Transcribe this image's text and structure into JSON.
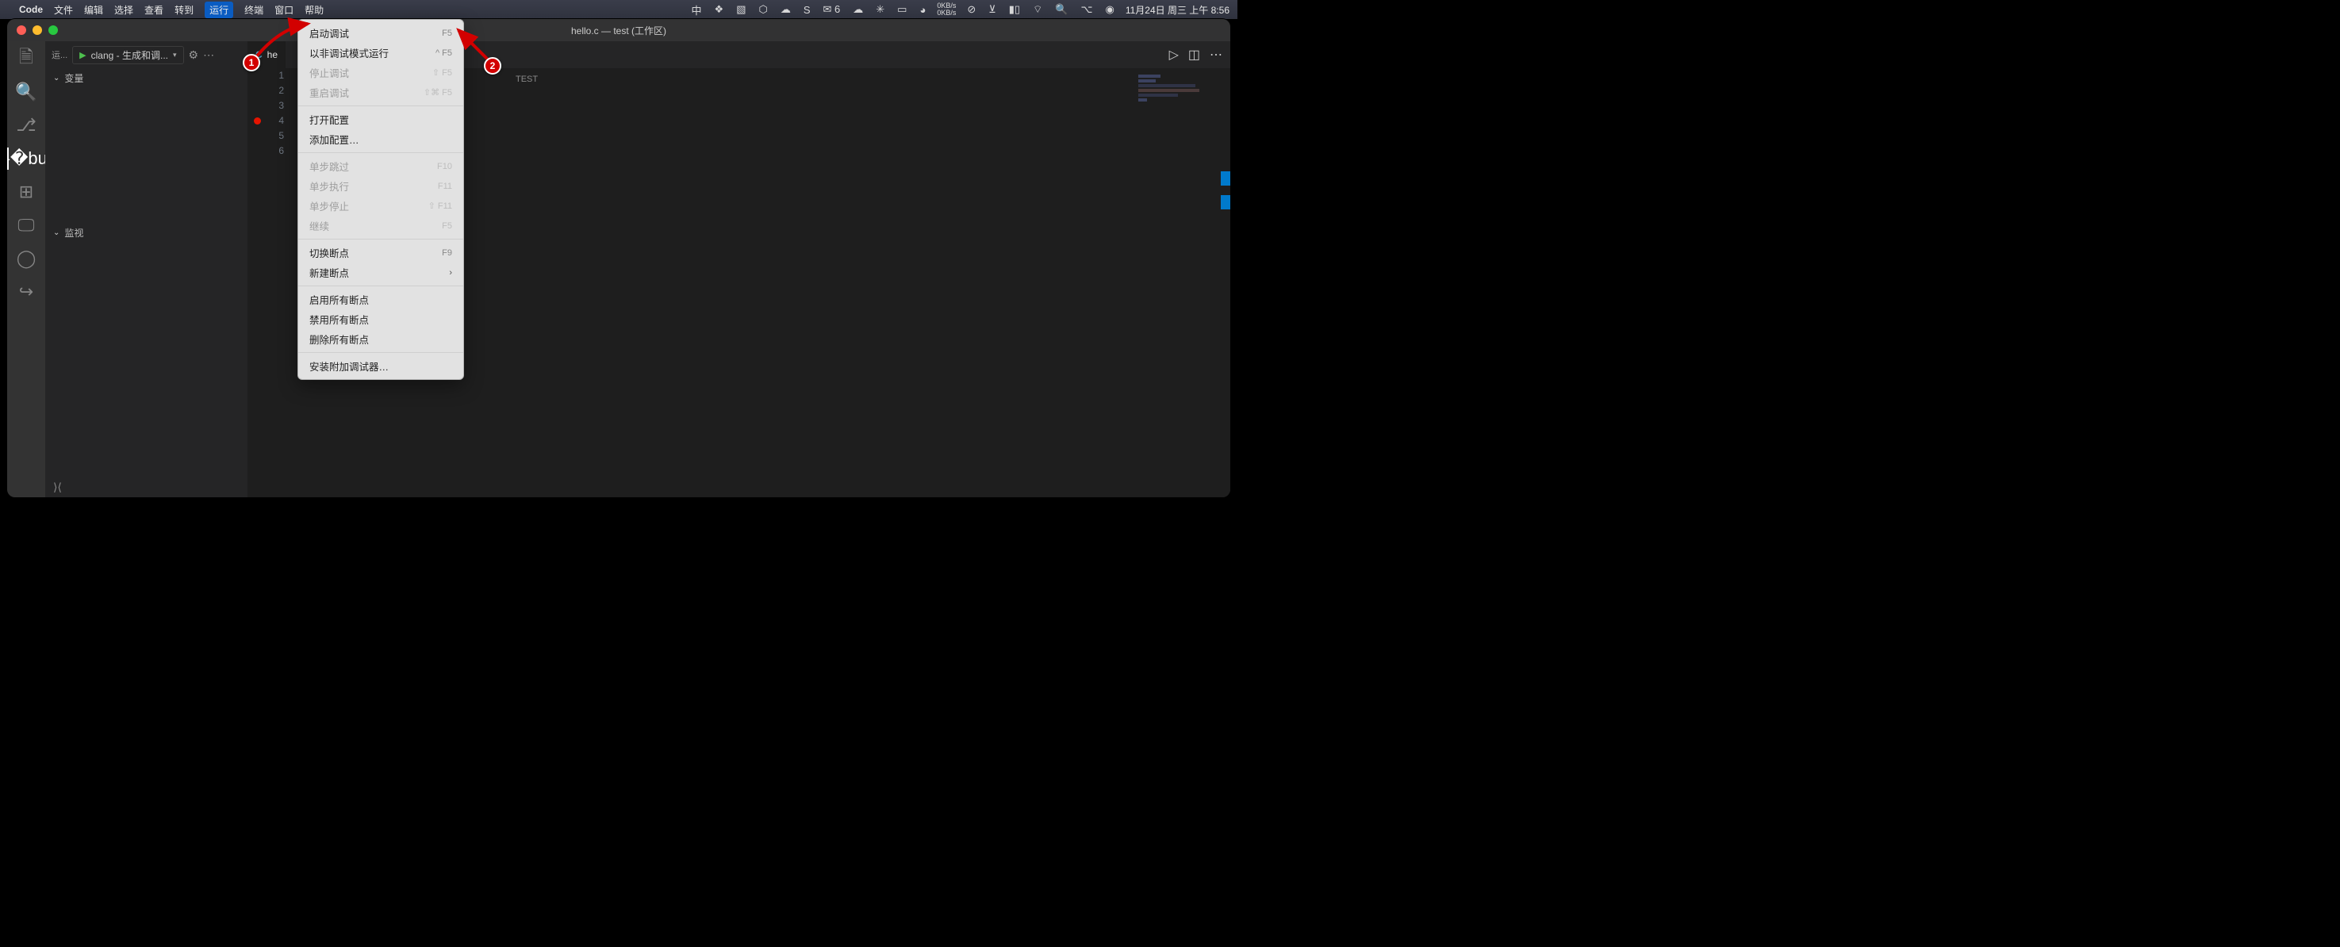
{
  "menubar": {
    "app": "Code",
    "items": [
      "文件",
      "编辑",
      "选择",
      "查看",
      "转到",
      "运行",
      "终端",
      "窗口",
      "帮助"
    ],
    "active_index": 5,
    "ime": "中",
    "netspeed_up": "0KB/s",
    "netspeed_down": "0KB/s",
    "wechat_badge": "6",
    "clock": "11月24日 周三 上午 8:56"
  },
  "window": {
    "title": "hello.c — test (工作区)"
  },
  "debug": {
    "label_short": "运...",
    "config": "clang - 生成和调..."
  },
  "sidebar": {
    "sections": [
      "变量",
      "监视"
    ]
  },
  "tab": {
    "icon": "C",
    "name_partial": "he"
  },
  "editor": {
    "topLabel": "TEST",
    "lines": [
      "1",
      "2",
      "3",
      "4",
      "5",
      "6"
    ],
    "visible_fragment": ");"
  },
  "dropdown": [
    {
      "label": "启动调试",
      "shortcut": "F5",
      "enabled": true
    },
    {
      "label": "以非调试模式运行",
      "shortcut": "^ F5",
      "enabled": true
    },
    {
      "label": "停止调试",
      "shortcut": "⇧ F5",
      "enabled": false
    },
    {
      "label": "重启调试",
      "shortcut": "⇧⌘ F5",
      "enabled": false
    },
    {
      "sep": true
    },
    {
      "label": "打开配置",
      "shortcut": "",
      "enabled": true
    },
    {
      "label": "添加配置…",
      "shortcut": "",
      "enabled": true
    },
    {
      "sep": true
    },
    {
      "label": "单步跳过",
      "shortcut": "F10",
      "enabled": false
    },
    {
      "label": "单步执行",
      "shortcut": "F11",
      "enabled": false
    },
    {
      "label": "单步停止",
      "shortcut": "⇧ F11",
      "enabled": false
    },
    {
      "label": "继续",
      "shortcut": "F5",
      "enabled": false
    },
    {
      "sep": true
    },
    {
      "label": "切换断点",
      "shortcut": "F9",
      "enabled": true
    },
    {
      "label": "新建断点",
      "shortcut": "",
      "enabled": true,
      "submenu": true
    },
    {
      "sep": true
    },
    {
      "label": "启用所有断点",
      "shortcut": "",
      "enabled": true
    },
    {
      "label": "禁用所有断点",
      "shortcut": "",
      "enabled": true
    },
    {
      "label": "删除所有断点",
      "shortcut": "",
      "enabled": true
    },
    {
      "sep": true
    },
    {
      "label": "安装附加调试器…",
      "shortcut": "",
      "enabled": true
    }
  ],
  "annotations": {
    "b1": "1",
    "b2": "2"
  }
}
